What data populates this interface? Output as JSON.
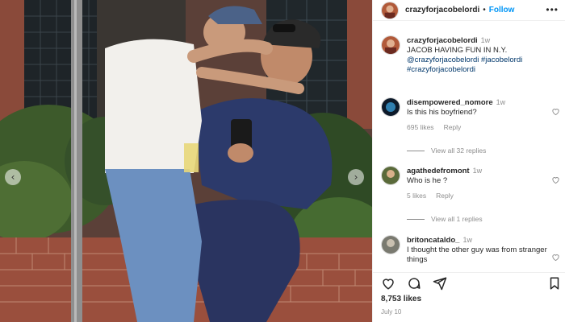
{
  "post": {
    "username": "crazyforjacobelordi",
    "follow_label": "Follow",
    "caption": {
      "username": "crazyforjacobelordi",
      "age": "1w",
      "text": "JACOB HAVING FUN IN N.Y.",
      "tags_line1": "@crazyforjacobelordi #jacobelordi",
      "tags_line2": "#crazyforjacobelordi"
    },
    "likes": "8,753 likes",
    "date": "July 10"
  },
  "comments": [
    {
      "username": "disempowered_nomore",
      "age": "1w",
      "text": "Is this his boyfriend?",
      "likes": "695 likes",
      "reply": "Reply",
      "view_replies": "View all 32 replies"
    },
    {
      "username": "agathedefromont",
      "age": "1w",
      "text": "Who is he ?",
      "likes": "5 likes",
      "reply": "Reply",
      "view_replies": "View all 1 replies"
    },
    {
      "username": "britoncataldo_",
      "age": "1w",
      "text": "I thought the other guy was from stranger things"
    }
  ],
  "colors": {
    "link": "#0095f6",
    "hashtag": "#00376b",
    "muted": "#8e8e8e"
  },
  "icons": [
    "more-icon",
    "heart-icon",
    "comment-icon",
    "share-icon",
    "bookmark-icon",
    "chevron-left-icon",
    "chevron-right-icon"
  ]
}
